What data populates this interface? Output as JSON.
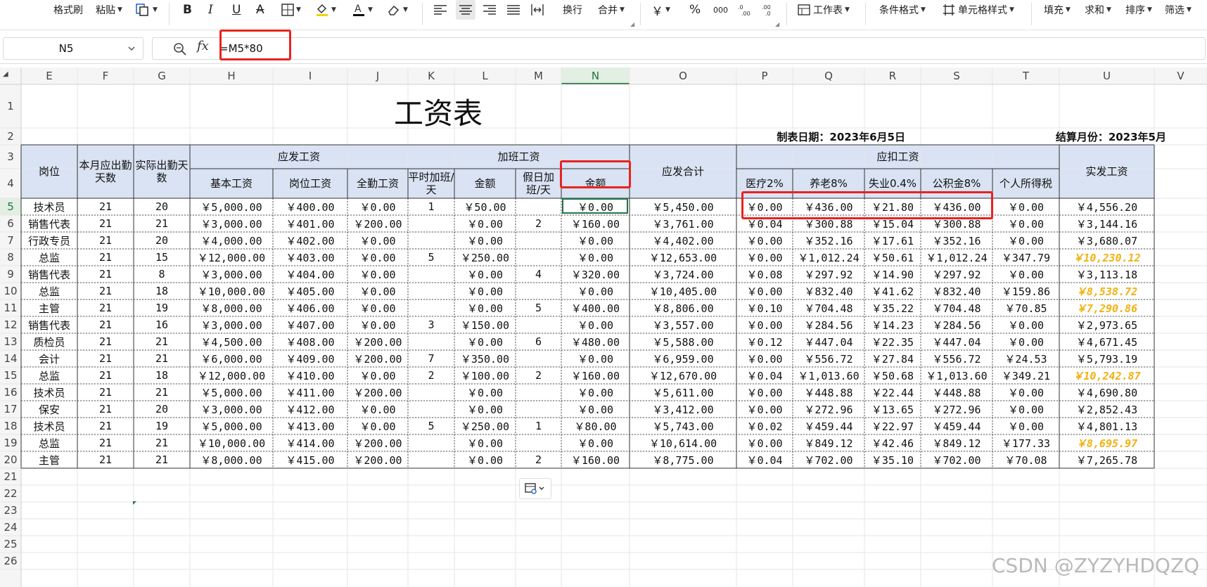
{
  "ribbon": {
    "format_painter": "格式刷",
    "paste": "粘贴",
    "wrap_text": "换行",
    "merge": "合并",
    "currency": "￥",
    "percent": "%",
    "thousands": "000",
    "worksheet": "工作表",
    "conditional_format": "条件格式",
    "cell_style": "单元格样式",
    "fill": "填充",
    "sum": "求和",
    "sort": "排序",
    "filter": "筛选"
  },
  "formula_bar": {
    "name_box": "N5",
    "formula": "=M5*80"
  },
  "columns": [
    "E",
    "F",
    "G",
    "H",
    "I",
    "J",
    "K",
    "L",
    "M",
    "N",
    "O",
    "P",
    "Q",
    "R",
    "S",
    "T",
    "U",
    "V"
  ],
  "rows": [
    "1",
    "2",
    "3",
    "4",
    "5",
    "6",
    "7",
    "8",
    "9",
    "10",
    "11",
    "12",
    "13",
    "14",
    "15",
    "16",
    "17",
    "18",
    "19",
    "20",
    "21",
    "22",
    "23",
    "24",
    "25",
    "26"
  ],
  "sheet": {
    "title": "工资表",
    "date_label": "制表日期：2023年6月5日",
    "month_label": "结算月份：2023年5月",
    "headers": {
      "position": "岗位",
      "required_days": "本月应出勤天数",
      "actual_days": "实际出勤天数",
      "gross_group": "应发工资",
      "base": "基本工资",
      "post": "岗位工资",
      "full_att": "全勤工资",
      "ot_group": "加班工资",
      "weekday_ot": "平时加班/天",
      "amount1": "金额",
      "holiday_ot": "假日加班/天",
      "amount2": "金额",
      "gross_total": "应发合计",
      "deduct_group": "应扣工资",
      "medical": "医疗2%",
      "pension": "养老8%",
      "unemployment": "失业0.4%",
      "housing": "公积金8%",
      "tax": "个人所得税",
      "net": "实发工资"
    },
    "records": [
      [
        "技术员",
        "21",
        "20",
        "￥5,000.00",
        "￥400.00",
        "￥0.00",
        "1",
        "￥50.00",
        "",
        "￥0.00",
        "￥5,450.00",
        "￥0.00",
        "￥436.00",
        "￥21.80",
        "￥436.00",
        "￥0.00",
        "￥4,556.20"
      ],
      [
        "销售代表",
        "21",
        "21",
        "￥3,000.00",
        "￥401.00",
        "￥200.00",
        "",
        "￥0.00",
        "2",
        "￥160.00",
        "￥3,761.00",
        "￥0.04",
        "￥300.88",
        "￥15.04",
        "￥300.88",
        "￥0.00",
        "￥3,144.16"
      ],
      [
        "行政专员",
        "21",
        "20",
        "￥4,000.00",
        "￥402.00",
        "￥0.00",
        "",
        "￥0.00",
        "",
        "￥0.00",
        "￥4,402.00",
        "￥0.00",
        "￥352.16",
        "￥17.61",
        "￥352.16",
        "￥0.00",
        "￥3,680.07"
      ],
      [
        "总监",
        "21",
        "15",
        "￥12,000.00",
        "￥403.00",
        "￥0.00",
        "5",
        "￥250.00",
        "",
        "￥0.00",
        "￥12,653.00",
        "￥0.00",
        "￥1,012.24",
        "￥50.61",
        "￥1,012.24",
        "￥347.79",
        "￥10,230.12"
      ],
      [
        "销售代表",
        "21",
        "8",
        "￥3,000.00",
        "￥404.00",
        "￥0.00",
        "",
        "￥0.00",
        "4",
        "￥320.00",
        "￥3,724.00",
        "￥0.08",
        "￥297.92",
        "￥14.90",
        "￥297.92",
        "￥0.00",
        "￥3,113.18"
      ],
      [
        "总监",
        "21",
        "18",
        "￥10,000.00",
        "￥405.00",
        "￥0.00",
        "",
        "￥0.00",
        "",
        "￥0.00",
        "￥10,405.00",
        "￥0.00",
        "￥832.40",
        "￥41.62",
        "￥832.40",
        "￥159.86",
        "￥8,538.72"
      ],
      [
        "主管",
        "21",
        "19",
        "￥8,000.00",
        "￥406.00",
        "￥0.00",
        "",
        "￥0.00",
        "5",
        "￥400.00",
        "￥8,806.00",
        "￥0.10",
        "￥704.48",
        "￥35.22",
        "￥704.48",
        "￥70.85",
        "￥7,290.86"
      ],
      [
        "销售代表",
        "21",
        "16",
        "￥3,000.00",
        "￥407.00",
        "￥0.00",
        "3",
        "￥150.00",
        "",
        "￥0.00",
        "￥3,557.00",
        "￥0.00",
        "￥284.56",
        "￥14.23",
        "￥284.56",
        "￥0.00",
        "￥2,973.65"
      ],
      [
        "质检员",
        "21",
        "21",
        "￥4,500.00",
        "￥408.00",
        "￥200.00",
        "",
        "￥0.00",
        "6",
        "￥480.00",
        "￥5,588.00",
        "￥0.12",
        "￥447.04",
        "￥22.35",
        "￥447.04",
        "￥0.00",
        "￥4,671.45"
      ],
      [
        "会计",
        "21",
        "21",
        "￥6,000.00",
        "￥409.00",
        "￥200.00",
        "7",
        "￥350.00",
        "",
        "￥0.00",
        "￥6,959.00",
        "￥0.00",
        "￥556.72",
        "￥27.84",
        "￥556.72",
        "￥24.53",
        "￥5,793.19"
      ],
      [
        "总监",
        "21",
        "18",
        "￥12,000.00",
        "￥410.00",
        "￥0.00",
        "2",
        "￥100.00",
        "2",
        "￥160.00",
        "￥12,670.00",
        "￥0.04",
        "￥1,013.60",
        "￥50.68",
        "￥1,013.60",
        "￥349.21",
        "￥10,242.87"
      ],
      [
        "技术员",
        "21",
        "21",
        "￥5,000.00",
        "￥411.00",
        "￥200.00",
        "",
        "￥0.00",
        "",
        "￥0.00",
        "￥5,611.00",
        "￥0.00",
        "￥448.88",
        "￥22.44",
        "￥448.88",
        "￥0.00",
        "￥4,690.80"
      ],
      [
        "保安",
        "21",
        "20",
        "￥3,000.00",
        "￥412.00",
        "￥0.00",
        "",
        "￥0.00",
        "",
        "￥0.00",
        "￥3,412.00",
        "￥0.00",
        "￥272.96",
        "￥13.65",
        "￥272.96",
        "￥0.00",
        "￥2,852.43"
      ],
      [
        "技术员",
        "21",
        "19",
        "￥5,000.00",
        "￥413.00",
        "￥0.00",
        "5",
        "￥250.00",
        "1",
        "￥80.00",
        "￥5,743.00",
        "￥0.02",
        "￥459.44",
        "￥22.97",
        "￥459.44",
        "￥0.00",
        "￥4,801.13"
      ],
      [
        "总监",
        "21",
        "21",
        "￥10,000.00",
        "￥414.00",
        "￥200.00",
        "",
        "￥0.00",
        "",
        "￥0.00",
        "￥10,614.00",
        "￥0.00",
        "￥849.12",
        "￥42.46",
        "￥849.12",
        "￥177.33",
        "￥8,695.97"
      ],
      [
        "主管",
        "21",
        "21",
        "￥8,000.00",
        "￥415.00",
        "￥200.00",
        "",
        "￥0.00",
        "2",
        "￥160.00",
        "￥8,775.00",
        "￥0.04",
        "￥702.00",
        "￥35.10",
        "￥702.00",
        "￥70.08",
        "￥7,265.78"
      ]
    ],
    "highlight_net_rows": [
      3,
      5,
      6,
      10,
      14
    ]
  },
  "watermark": "CSDN @ZYZYHDQZQ",
  "colors": {
    "header_fill": "#dae3f3",
    "highlight_red": "#e8231f",
    "active_green": "#217346",
    "gold_text": "#f2b10f"
  }
}
